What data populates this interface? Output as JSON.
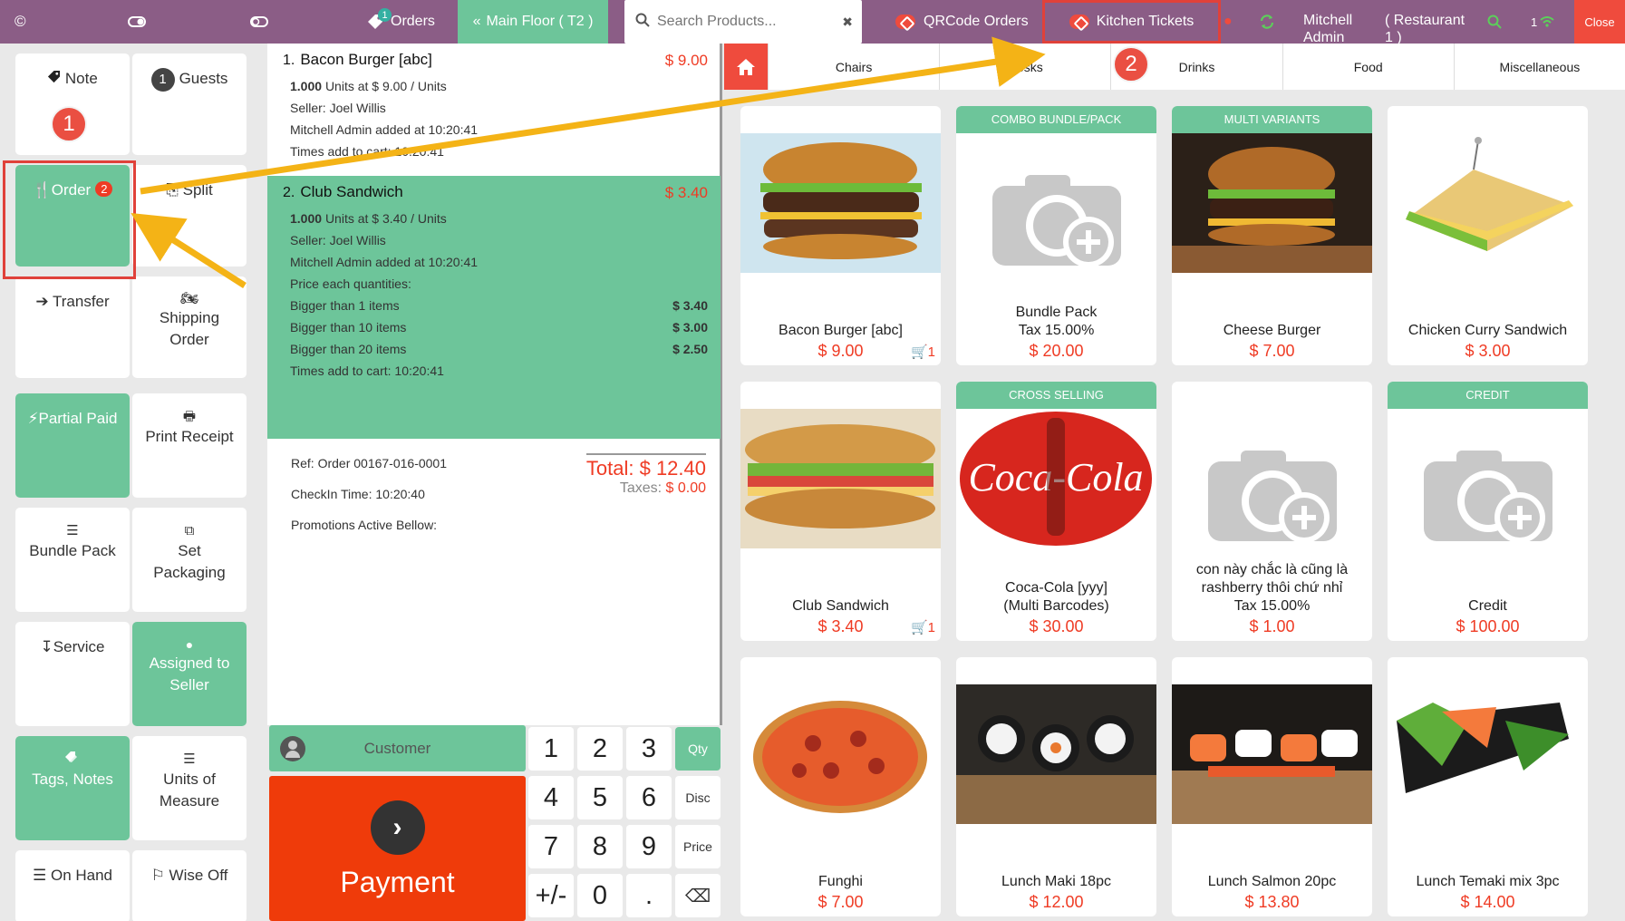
{
  "topbar": {
    "orders_badge": "1",
    "orders_label": "Orders",
    "main_floor_label": "Main Floor ( T2 )",
    "search_placeholder": "Search Products...",
    "qr_orders_label": "QRCode Orders",
    "kitchen_label": "Kitchen Tickets",
    "user_name": "Mitchell Admin",
    "restaurant": "( Restaurant 1 )",
    "signal_count": "1",
    "close_label": "Close"
  },
  "actions": {
    "note": "Note",
    "guests_count": "1",
    "guests": "Guests",
    "order": "Order",
    "order_badge": "2",
    "split": "Split",
    "transfer": "Transfer",
    "shipping": "Shipping Order",
    "partial_paid": "Partial Paid",
    "print_receipt": "Print Receipt",
    "bundle_pack": "Bundle Pack",
    "set_packaging": "Set Packaging",
    "service": "Service",
    "assigned_seller": "Assigned to Seller",
    "tags_notes": "Tags, Notes",
    "units_measure": "Units of Measure",
    "on_hand": "On Hand",
    "wise_off": "Wise Off"
  },
  "order_lines": [
    {
      "index": "1.",
      "name": "Bacon Burger [abc]",
      "price": "$ 9.00",
      "units_qty": "1.000",
      "units_text": "Units at $ 9.00 / Units",
      "seller": "Seller: Joel Willis",
      "added": "Mitchell Admin added at 10:20:41",
      "times": "Times add to cart: 10:20:41"
    },
    {
      "index": "2.",
      "name": "Club Sandwich",
      "price": "$ 3.40",
      "units_qty": "1.000",
      "units_text": "Units at $ 3.40 / Units",
      "seller": "Seller: Joel Willis",
      "added": "Mitchell Admin added at 10:20:41",
      "price_each": "Price each quantities:",
      "tiers": [
        {
          "label": "Bigger than 1 items",
          "value": "$ 3.40"
        },
        {
          "label": "Bigger than 10 items",
          "value": "$ 3.00"
        },
        {
          "label": "Bigger than 20 items",
          "value": "$ 2.50"
        }
      ],
      "times": "Times add to cart: 10:20:41"
    }
  ],
  "summary": {
    "ref": "Ref: Order 00167-016-0001",
    "checkin": "CheckIn Time: 10:20:40",
    "promotions": "Promotions Active Bellow:",
    "total_label": "Total:",
    "total_value": "$ 12.40",
    "taxes_label": "Taxes:",
    "taxes_value": "$ 0.00"
  },
  "numpad": {
    "customer": "Customer",
    "payment": "Payment",
    "keys": [
      "1",
      "2",
      "3",
      "4",
      "5",
      "6",
      "7",
      "8",
      "9",
      "+/-",
      "0",
      "."
    ],
    "qty": "Qty",
    "disc": "Disc",
    "price": "Price",
    "backspace": "⌫"
  },
  "categories": [
    "Chairs",
    "Desks",
    "Drinks",
    "Food",
    "Miscellaneous"
  ],
  "products": [
    {
      "name": "Bacon Burger [abc]",
      "price": "$ 9.00",
      "ribbon": "",
      "cart": "1",
      "image": "burger"
    },
    {
      "name": "Bundle Pack\nTax 15.00%",
      "price": "$ 20.00",
      "ribbon": "COMBO BUNDLE/PACK",
      "cart": "",
      "image": "placeholder"
    },
    {
      "name": "Cheese Burger",
      "price": "$ 7.00",
      "ribbon": "MULTI VARIANTS",
      "cart": "",
      "image": "burger-dark"
    },
    {
      "name": "Chicken Curry Sandwich",
      "price": "$ 3.00",
      "ribbon": "",
      "cart": "",
      "image": "sandwich-triangle"
    },
    {
      "name": "Club Sandwich",
      "price": "$ 3.40",
      "ribbon": "",
      "cart": "1",
      "image": "sub-sandwich"
    },
    {
      "name": "Coca-Cola [yyy]\n(Multi Barcodes)",
      "price": "$ 30.00",
      "ribbon": "CROSS SELLING",
      "cart": "",
      "image": "coca-cola"
    },
    {
      "name": "con này chắc là cũng là rashberry thôi chứ nhỉ\nTax 15.00%",
      "price": "$ 1.00",
      "ribbon": "",
      "cart": "",
      "image": "placeholder"
    },
    {
      "name": "Credit",
      "price": "$ 100.00",
      "ribbon": "CREDIT",
      "cart": "",
      "image": "placeholder"
    },
    {
      "name": "Funghi",
      "price": "$ 7.00",
      "ribbon": "",
      "cart": "",
      "image": "pizza"
    },
    {
      "name": "Lunch Maki 18pc",
      "price": "$ 12.00",
      "ribbon": "",
      "cart": "",
      "image": "maki"
    },
    {
      "name": "Lunch Salmon 20pc",
      "price": "$ 13.80",
      "ribbon": "",
      "cart": "",
      "image": "salmon"
    },
    {
      "name": "Lunch Temaki mix 3pc",
      "price": "$ 14.00",
      "ribbon": "",
      "cart": "",
      "image": "temaki"
    }
  ],
  "coca_cola_text": "Coca-Cola",
  "annotations": [
    "1",
    "2"
  ],
  "colors": {
    "topbar": "#8b5d86",
    "accent_green": "#6dc59a",
    "accent_red": "#ef3b24",
    "annotation_red": "#e0413a",
    "arrow_yellow": "#f4b316"
  }
}
